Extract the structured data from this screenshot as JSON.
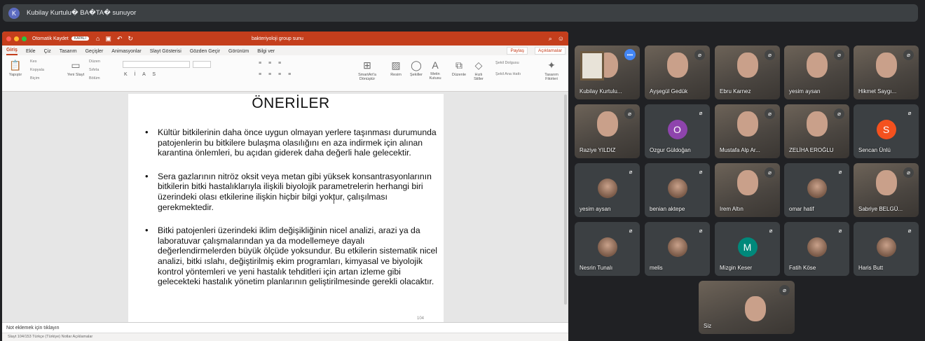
{
  "presenter": {
    "initial": "K",
    "text": "Kubilay Kurtulu� BA�TA� sunuyor"
  },
  "ppt": {
    "autosave": "Otomatik Kaydet",
    "toggle": "KAPALI",
    "doc_title": "bakteriyoloji group sunu",
    "tabs": [
      "Giriş",
      "Ekle",
      "Çiz",
      "Tasarım",
      "Geçişler",
      "Animasyonlar",
      "Slayt Gösterisi",
      "Gözden Geçir",
      "Görünüm",
      "Bilgi ver"
    ],
    "share": "Paylaş",
    "comments": "Açıklamalar",
    "ribbon": {
      "paste": "Yapıştır",
      "cut": "Kes",
      "copy": "Kopyala",
      "format": "Biçim",
      "new_slide": "Yeni Slayt",
      "layout": "Düzen",
      "reset": "Sıfırla",
      "section": "Bölüm",
      "smartart": "SmartArt'a Dönüştür",
      "picture": "Resim",
      "shapes": "Şekiller",
      "textbox": "Metin Kutusu",
      "arrange": "Düzenle",
      "quick_styles": "Hızlı Stiller",
      "shape_fill": "Şekil Dolgusu",
      "shape_outline": "Şekil Ana Hattı",
      "design_ideas": "Tasarım Fikirleri"
    },
    "slide": {
      "title": "ÖNERİLER",
      "bullets": [
        "Kültür bitkilerinin daha önce uygun olmayan yerlere taşınması durumunda patojenlerin bu bitkilere bulaşma olasılığını en aza indirmek için alınan karantina önlemleri, bu açıdan giderek daha değerli hale gelecektir.",
        "Sera gazlarının nitröz oksit veya metan gibi yüksek konsantrasyonlarının bitkilerin bitki hastalıklarıyla ilişkili biyolojik parametrelerin herhangi biri üzerindeki olası etkilerine ilişkin hiçbir bilgi yoktur, çalışılması gerekmektedir.",
        "Bitki patojenleri üzerindeki iklim değişikliğinin nicel analizi, arazi ya da laboratuvar çalışmalarından ya da modellemeye dayalı değerlendirmelerden büyük ölçüde yoksundur. Bu etkilerin sistematik nicel analizi, bitki ıslahı, değiştirilmiş ekim programları, kimyasal ve biyolojik kontrol yöntemleri ve yeni hastalık tehditleri için artan izleme gibi gelecekteki hastalık yönetim planlarının geliştirilmesinde gerekli olacaktır."
      ],
      "page_number": "104"
    },
    "notes_placeholder": "Not eklemek için tıklayın",
    "status": "Slayt 104/153    Türkçe (Türkiye)                                                                                                                                            Notlar    Açıklamalar"
  },
  "participants": [
    {
      "name": "Kubilay Kurtulu...",
      "type": "presenter"
    },
    {
      "name": "Ayşegül Gedük",
      "type": "video"
    },
    {
      "name": "Ebru Karnez",
      "type": "video"
    },
    {
      "name": "yesim aysan",
      "type": "video"
    },
    {
      "name": "Hikmet Saygı...",
      "type": "video"
    },
    {
      "name": "Raziye YILDIZ",
      "type": "video"
    },
    {
      "name": "Ozgur Güldoğan",
      "type": "letter",
      "letter": "O",
      "color": "#8e44ad"
    },
    {
      "name": "Mustafa Alp Ar...",
      "type": "video"
    },
    {
      "name": "ZELİHA EROĞLU",
      "type": "video"
    },
    {
      "name": "Sencan Ünlü",
      "type": "letter",
      "letter": "S",
      "color": "#f4511e"
    },
    {
      "name": "yesim aysan",
      "type": "pic"
    },
    {
      "name": "benian aktepe",
      "type": "pic"
    },
    {
      "name": "Irem Altın",
      "type": "video"
    },
    {
      "name": "omar hatif",
      "type": "pic"
    },
    {
      "name": "Sabriye BELGÜ...",
      "type": "video"
    },
    {
      "name": "Nesrin Tunalı",
      "type": "pic"
    },
    {
      "name": "melis",
      "type": "pic"
    },
    {
      "name": "Mizgin Keser",
      "type": "letter",
      "letter": "M",
      "color": "#00897b"
    },
    {
      "name": "Fatih Köse",
      "type": "pic"
    },
    {
      "name": "Haris Butt",
      "type": "pic"
    }
  ],
  "self_tile": {
    "name": "Siz"
  }
}
